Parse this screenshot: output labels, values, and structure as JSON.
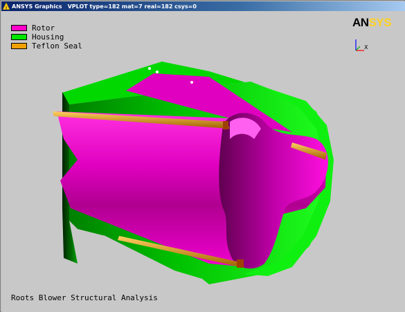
{
  "window": {
    "app_name": "ANSYS Graphics",
    "info": "VPLOT  type=182 mat=7 real=182 csys=0"
  },
  "legend": {
    "items": [
      {
        "label": "Rotor",
        "color": "#ff00c8"
      },
      {
        "label": "Housing",
        "color": "#00e600"
      },
      {
        "label": "Teflon Seal",
        "color": "#f0a000"
      }
    ]
  },
  "logo": {
    "part1": "AN",
    "part2": "SYS"
  },
  "triad": {
    "axis_label": "X"
  },
  "plot_title": "Roots Blower Structural Analysis",
  "colors": {
    "background": "#c8c8c8",
    "rotor": "#ff00c8",
    "housing": "#00e600",
    "seal": "#f0a000"
  }
}
